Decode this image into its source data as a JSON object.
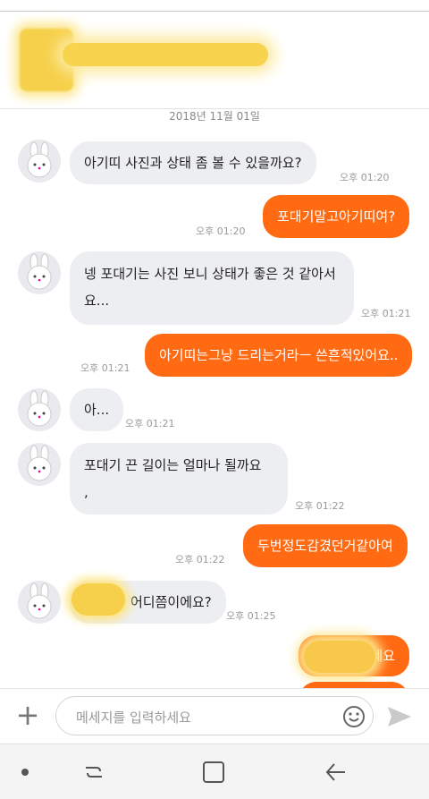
{
  "date_divider": "2018년 11월 01일",
  "composer": {
    "placeholder": "메세지를 입력하세요",
    "plus_icon": "plus-icon",
    "emoji_icon": "smiley-icon",
    "send_icon": "send-arrow-icon"
  },
  "messages": [
    {
      "from": "them",
      "text": "아기띠 사진과 상태 좀 볼 수 있을까요?",
      "time": "오후 01:20"
    },
    {
      "from": "me",
      "text": "포대기말고아기띠여?",
      "time": "오후 01:20"
    },
    {
      "from": "them",
      "text": "넹 포대기는 사진 보니 상태가 좋은 것 같아서요...",
      "time": "오후 01:21"
    },
    {
      "from": "me",
      "text": "아기띠는그냥 드리는거라ㅡ 쓴흔적있어요..",
      "time": "오후 01:21"
    },
    {
      "from": "them",
      "text": "아...",
      "time": "오후 01:21"
    },
    {
      "from": "them",
      "text": "포대기 끈 길이는 얼마나 될까요\n,",
      "time": "오후 01:22"
    },
    {
      "from": "me",
      "text": "두번정도감겼던거같아여",
      "time": "오후 01:22"
    },
    {
      "from": "them",
      "text": "어디쯤이에요?",
      "time": "오후 01:25"
    },
    {
      "from": "me",
      "text": "세요",
      "time": ""
    }
  ],
  "navbar": {
    "icons": [
      "nav-dot-icon",
      "recent-apps-icon",
      "home-icon",
      "back-icon"
    ]
  },
  "colors": {
    "outgoing_bubble": "#ff6a13",
    "incoming_bubble": "#edeef1"
  }
}
